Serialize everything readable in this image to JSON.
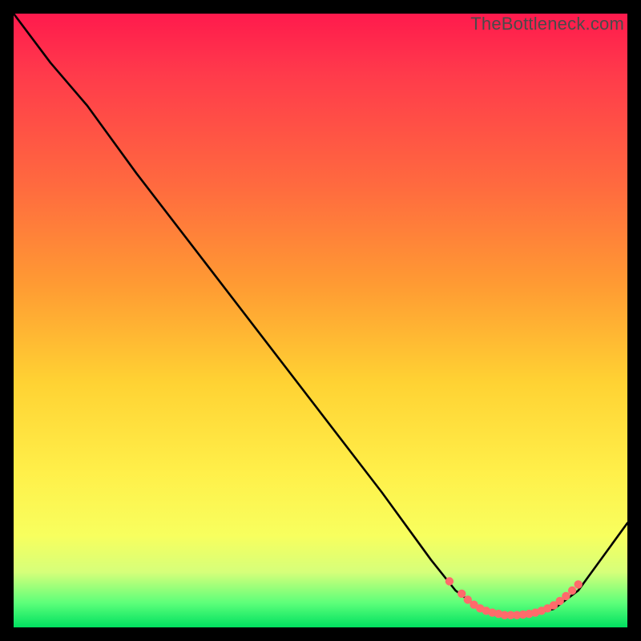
{
  "watermark": "TheBottleneck.com",
  "colors": {
    "frame": "#000000",
    "curve": "#000000",
    "marker": "#ff6b6b",
    "gradient_top": "#ff1a4d",
    "gradient_bottom": "#00e060"
  },
  "chart_data": {
    "type": "line",
    "title": "",
    "xlabel": "",
    "ylabel": "",
    "xlim": [
      0,
      100
    ],
    "ylim": [
      0,
      100
    ],
    "grid": false,
    "legend": false,
    "series": [
      {
        "name": "bottleneck-curve",
        "x": [
          0,
          6,
          12,
          20,
          30,
          40,
          50,
          60,
          68,
          72,
          76,
          80,
          84,
          88,
          92,
          100
        ],
        "y": [
          100,
          92,
          85,
          74,
          61,
          48,
          35,
          22,
          11,
          6,
          3,
          2,
          2,
          3,
          6,
          17
        ]
      }
    ],
    "markers": {
      "name": "highlight-dots",
      "x": [
        71,
        73,
        74,
        75,
        76,
        77,
        78,
        79,
        80,
        81,
        82,
        83,
        84,
        85,
        86,
        87,
        88,
        89,
        90,
        91,
        92
      ],
      "y": [
        7.5,
        5.5,
        4.5,
        3.7,
        3.1,
        2.7,
        2.4,
        2.2,
        2.0,
        2.0,
        2.0,
        2.1,
        2.2,
        2.4,
        2.7,
        3.1,
        3.6,
        4.3,
        5.1,
        6.0,
        7.0
      ]
    }
  }
}
